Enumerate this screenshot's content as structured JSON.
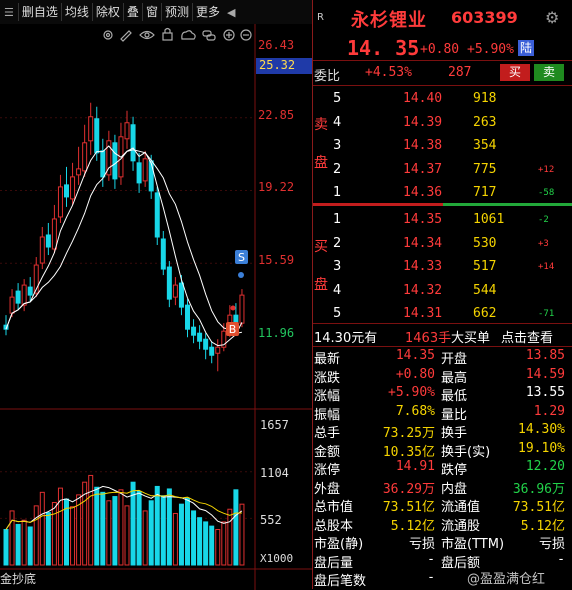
{
  "toolbar": {
    "items": [
      "删自选",
      "均线",
      "除权",
      "叠",
      "窗",
      "预测",
      "更多"
    ],
    "arrow_left": "◀",
    "menu": "☰",
    "icons": [
      "settings-icon",
      "eye-icon",
      "lock-icon",
      "cloud-icon",
      "chain-icon",
      "plus-circle-icon",
      "minus-circle-icon"
    ]
  },
  "chart": {
    "price_levels": [
      "26.43",
      "25.32",
      "22.85",
      "19.22",
      "15.59",
      "11.96"
    ],
    "volume_levels": [
      "1657",
      "1104",
      "552",
      "X1000"
    ],
    "signal_s": "S",
    "signal_b": "B",
    "bottom_label": "金抄底",
    "candles": [
      {
        "o": 12.5,
        "c": 12.3,
        "h": 13.0,
        "l": 12.0,
        "v": 420
      },
      {
        "o": 13.1,
        "c": 13.9,
        "h": 14.3,
        "l": 12.9,
        "v": 640
      },
      {
        "o": 14.2,
        "c": 13.6,
        "h": 14.6,
        "l": 13.3,
        "v": 480
      },
      {
        "o": 13.5,
        "c": 14.5,
        "h": 14.8,
        "l": 13.2,
        "v": 530
      },
      {
        "o": 14.4,
        "c": 14.0,
        "h": 14.9,
        "l": 13.7,
        "v": 450
      },
      {
        "o": 14.1,
        "c": 15.5,
        "h": 15.9,
        "l": 13.9,
        "v": 700
      },
      {
        "o": 15.6,
        "c": 16.9,
        "h": 17.4,
        "l": 15.3,
        "v": 860
      },
      {
        "o": 17.0,
        "c": 16.4,
        "h": 17.6,
        "l": 16.0,
        "v": 620
      },
      {
        "o": 16.3,
        "c": 17.8,
        "h": 18.5,
        "l": 16.1,
        "v": 740
      },
      {
        "o": 17.9,
        "c": 19.4,
        "h": 20.0,
        "l": 17.6,
        "v": 910
      },
      {
        "o": 19.5,
        "c": 18.9,
        "h": 20.4,
        "l": 18.4,
        "v": 780
      },
      {
        "o": 18.8,
        "c": 19.9,
        "h": 20.6,
        "l": 18.5,
        "v": 690
      },
      {
        "o": 20.0,
        "c": 20.3,
        "h": 21.4,
        "l": 19.5,
        "v": 830
      },
      {
        "o": 20.2,
        "c": 21.6,
        "h": 22.5,
        "l": 19.9,
        "v": 980
      },
      {
        "o": 21.7,
        "c": 22.9,
        "h": 23.6,
        "l": 21.0,
        "v": 1060
      },
      {
        "o": 22.8,
        "c": 21.1,
        "h": 23.4,
        "l": 20.7,
        "v": 920
      },
      {
        "o": 21.2,
        "c": 19.9,
        "h": 21.8,
        "l": 19.4,
        "v": 860
      },
      {
        "o": 20.0,
        "c": 21.7,
        "h": 22.2,
        "l": 19.7,
        "v": 760
      },
      {
        "o": 21.6,
        "c": 19.8,
        "h": 22.0,
        "l": 19.3,
        "v": 810
      },
      {
        "o": 19.9,
        "c": 21.9,
        "h": 22.6,
        "l": 19.5,
        "v": 890
      },
      {
        "o": 21.8,
        "c": 22.6,
        "h": 23.2,
        "l": 21.3,
        "v": 700
      },
      {
        "o": 22.5,
        "c": 20.7,
        "h": 22.9,
        "l": 20.2,
        "v": 980
      },
      {
        "o": 20.6,
        "c": 19.6,
        "h": 21.1,
        "l": 19.1,
        "v": 870
      },
      {
        "o": 19.7,
        "c": 20.8,
        "h": 21.2,
        "l": 19.4,
        "v": 640
      },
      {
        "o": 20.7,
        "c": 19.2,
        "h": 21.0,
        "l": 18.8,
        "v": 760
      },
      {
        "o": 19.1,
        "c": 16.9,
        "h": 19.4,
        "l": 16.5,
        "v": 930
      },
      {
        "o": 16.8,
        "c": 15.3,
        "h": 17.2,
        "l": 15.0,
        "v": 820
      },
      {
        "o": 15.4,
        "c": 13.8,
        "h": 15.7,
        "l": 13.4,
        "v": 900
      },
      {
        "o": 13.9,
        "c": 14.5,
        "h": 14.9,
        "l": 13.5,
        "v": 610
      },
      {
        "o": 14.6,
        "c": 13.4,
        "h": 15.0,
        "l": 13.0,
        "v": 720
      },
      {
        "o": 13.5,
        "c": 12.3,
        "h": 13.8,
        "l": 11.9,
        "v": 790
      },
      {
        "o": 12.4,
        "c": 12.0,
        "h": 12.8,
        "l": 11.6,
        "v": 640
      },
      {
        "o": 12.1,
        "c": 11.7,
        "h": 12.5,
        "l": 11.3,
        "v": 560
      },
      {
        "o": 11.8,
        "c": 11.3,
        "h": 12.1,
        "l": 10.8,
        "v": 510
      },
      {
        "o": 11.4,
        "c": 11.0,
        "h": 11.7,
        "l": 10.6,
        "v": 460
      },
      {
        "o": 11.1,
        "c": 11.4,
        "h": 11.8,
        "l": 10.2,
        "v": 420
      },
      {
        "o": 11.4,
        "c": 12.2,
        "h": 12.6,
        "l": 11.2,
        "v": 510
      },
      {
        "o": 12.2,
        "c": 13.0,
        "h": 13.5,
        "l": 11.9,
        "v": 660
      },
      {
        "o": 13.0,
        "c": 12.6,
        "h": 13.6,
        "l": 12.3,
        "v": 890
      },
      {
        "o": 12.6,
        "c": 14.0,
        "h": 14.3,
        "l": 12.4,
        "v": 720
      }
    ]
  },
  "quote": {
    "flag": "R",
    "name": "永杉锂业",
    "code": "603399",
    "price": "14. 35",
    "change": "+0.80",
    "change_pct": "+5.90%",
    "badge": "陆",
    "weibi_label": "委比",
    "weibi_value": "+4.53%",
    "weicha": "287",
    "buy_btn": "买",
    "sell_btn": "卖",
    "sell_label": [
      "卖",
      "盘"
    ],
    "buy_label": [
      "买",
      "盘"
    ],
    "asks": [
      {
        "level": "5",
        "price": "14.40",
        "vol": "918",
        "diff": ""
      },
      {
        "level": "4",
        "price": "14.39",
        "vol": "263",
        "diff": ""
      },
      {
        "level": "3",
        "price": "14.38",
        "vol": "354",
        "diff": ""
      },
      {
        "level": "2",
        "price": "14.37",
        "vol": "775",
        "diff": "+12"
      },
      {
        "level": "1",
        "price": "14.36",
        "vol": "717",
        "diff": "-58"
      }
    ],
    "bids": [
      {
        "level": "1",
        "price": "14.35",
        "vol": "1061",
        "diff": "-2"
      },
      {
        "level": "2",
        "price": "14.34",
        "vol": "530",
        "diff": "+3"
      },
      {
        "level": "3",
        "price": "14.33",
        "vol": "517",
        "diff": "+14"
      },
      {
        "level": "4",
        "price": "14.32",
        "vol": "544",
        "diff": ""
      },
      {
        "level": "5",
        "price": "14.31",
        "vol": "662",
        "diff": "-71"
      }
    ],
    "trade": {
      "price": "14.30元有",
      "qty": "1463手",
      "type": "大买单",
      "link": "点击查看"
    },
    "stats": [
      {
        "l1": "最新",
        "v1": "14.35",
        "c1": "red",
        "l2": "开盘",
        "v2": "13.85",
        "c2": "red"
      },
      {
        "l1": "涨跌",
        "v1": "+0.80",
        "c1": "red",
        "l2": "最高",
        "v2": "14.59",
        "c2": "red"
      },
      {
        "l1": "涨幅",
        "v1": "+5.90%",
        "c1": "red",
        "l2": "最低",
        "v2": "13.55",
        "c2": "wht"
      },
      {
        "l1": "振幅",
        "v1": "7.68%",
        "c1": "yel",
        "l2": "量比",
        "v2": "1.29",
        "c2": "red"
      },
      {
        "l1": "总手",
        "v1": "73.25万",
        "c1": "yel",
        "l2": "换手",
        "v2": "14.30%",
        "c2": "yel"
      },
      {
        "l1": "金额",
        "v1": "10.35亿",
        "c1": "yel",
        "l2": "换手(实)",
        "v2": "19.10%",
        "c2": "yel"
      },
      {
        "l1": "涨停",
        "v1": "14.91",
        "c1": "red",
        "l2": "跌停",
        "v2": "12.20",
        "c2": "grn"
      },
      {
        "l1": "外盘",
        "v1": "36.29万",
        "c1": "red",
        "l2": "内盘",
        "v2": "36.96万",
        "c2": "grn"
      },
      {
        "l1": "总市值",
        "v1": "73.51亿",
        "c1": "yel",
        "l2": "流通值",
        "v2": "73.51亿",
        "c2": "yel"
      },
      {
        "l1": "总股本",
        "v1": "5.12亿",
        "c1": "yel",
        "l2": "流通股",
        "v2": "5.12亿",
        "c2": "yel"
      },
      {
        "l1": "市盈(静)",
        "v1": "亏损",
        "c1": "wht",
        "l2": "市盈(TTM)",
        "v2": "亏损",
        "c2": "wht"
      },
      {
        "l1": "盘后量",
        "v1": "-",
        "c1": "wht",
        "l2": "盘后额",
        "v2": "-",
        "c2": "wht"
      },
      {
        "l1": "盘后笔数",
        "v1": "-",
        "c1": "wht",
        "l2": "",
        "v2": "",
        "c2": "wht"
      }
    ],
    "watermark": "@盈盈满仓红"
  },
  "colors": {
    "up": "#e03030",
    "down": "#18d7e8",
    "ma1": "#ffffff",
    "ma2": "#f5d400"
  }
}
